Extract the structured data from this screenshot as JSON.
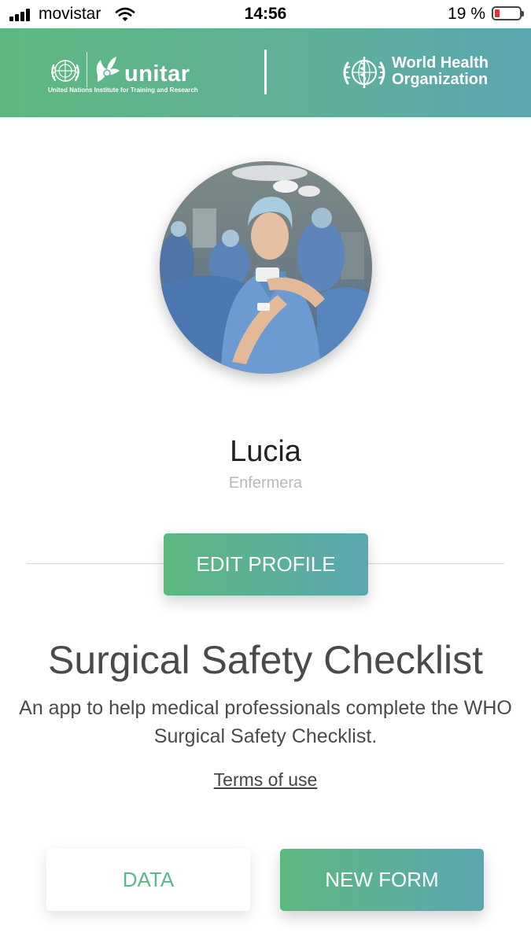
{
  "status_bar": {
    "carrier": "movistar",
    "time": "14:56",
    "battery_percent": "19 %",
    "battery_level": 0.19,
    "icons": [
      "signal-icon",
      "wifi-icon",
      "battery-icon"
    ]
  },
  "header": {
    "unitar_name": "unitar",
    "unitar_subtitle": "United Nations Institute for Training and Research",
    "who_name_line1": "World Health",
    "who_name_line2": "Organization"
  },
  "profile": {
    "name": "Lucia",
    "role": "Enfermera",
    "edit_label": "EDIT PROFILE"
  },
  "app": {
    "title": "Surgical Safety Checklist",
    "description": "An app to help medical professionals complete the WHO Surgical Safety Checklist.",
    "terms_label": "Terms of use"
  },
  "actions": {
    "data_label": "DATA",
    "new_form_label": "NEW FORM"
  },
  "colors": {
    "brand_green": "#5db87f",
    "brand_teal": "#5aa7b0",
    "battery_low": "#e33333"
  }
}
